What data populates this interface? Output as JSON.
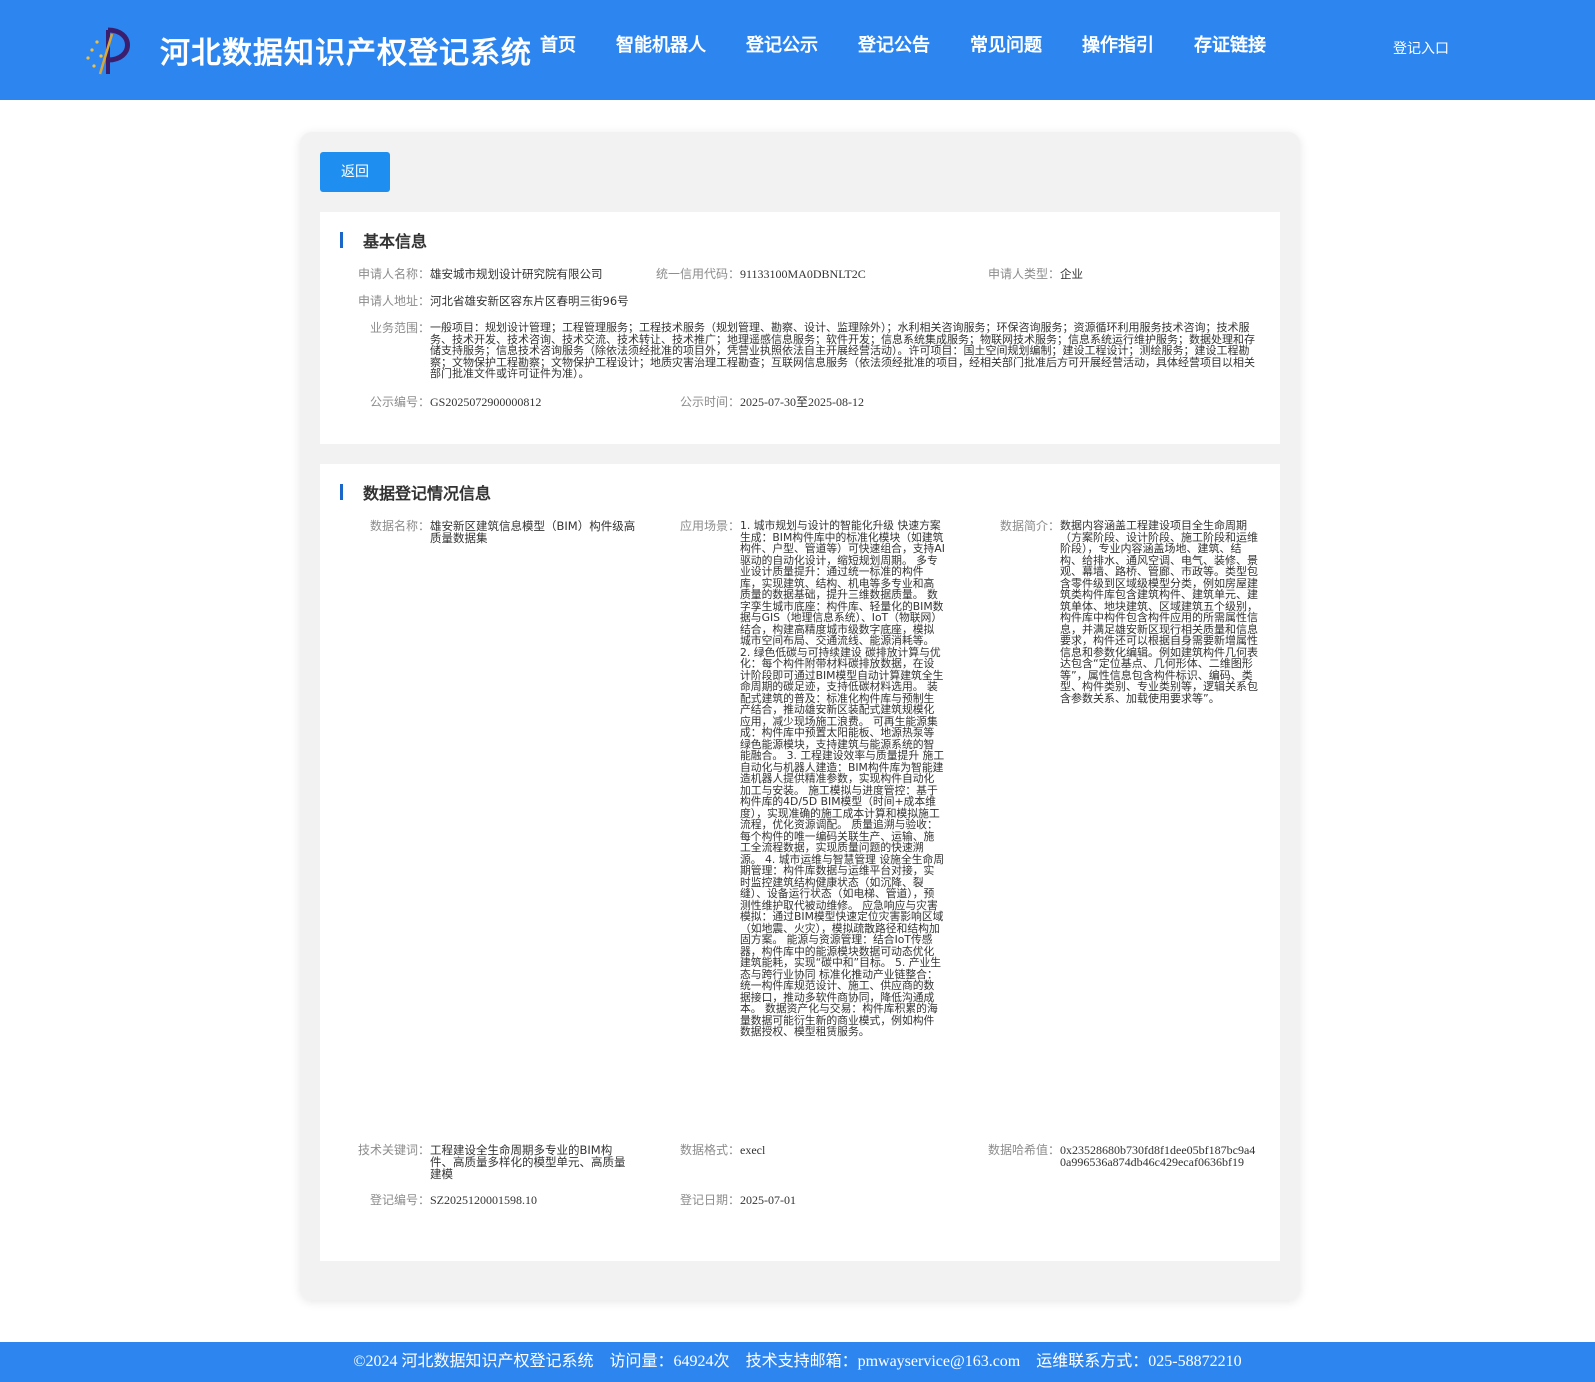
{
  "header": {
    "title": "河北数据知识产权登记系统",
    "nav": [
      "首页",
      "智能机器人",
      "登记公示",
      "登记公告",
      "常见问题",
      "操作指引",
      "存证链接"
    ],
    "login": "登记入口"
  },
  "back_label": "返回",
  "basic": {
    "title": "基本信息",
    "applicant_name_label": "申请人名称：",
    "applicant_name": "雄安城市规划设计研究院有限公司",
    "credit_code_label": "统一信用代码：",
    "credit_code": "91133100MA0DBNLT2C",
    "applicant_type_label": "申请人类型：",
    "applicant_type": "企业",
    "address_label": "申请人地址：",
    "address": "河北省雄安新区容东片区春明三街96号",
    "scope_label": "业务范围：",
    "scope": "一般项目：规划设计管理；工程管理服务；工程技术服务（规划管理、勘察、设计、监理除外）；水利相关咨询服务；环保咨询服务；资源循环利用服务技术咨询；技术服务、技术开发、技术咨询、技术交流、技术转让、技术推广；地理遥感信息服务；软件开发；信息系统集成服务；物联网技术服务；信息系统运行维护服务；数据处理和存储支持服务；信息技术咨询服务（除依法须经批准的项目外，凭营业执照依法自主开展经营活动）。许可项目：国土空间规划编制；建设工程设计；测绘服务；建设工程勘察；文物保护工程勘察；文物保护工程设计；地质灾害治理工程勘查；互联网信息服务（依法须经批准的项目，经相关部门批准后方可开展经营活动，具体经营项目以相关部门批准文件或许可证件为准）。",
    "notice_no_label": "公示编号：",
    "notice_no": "GS2025072900000812",
    "notice_time_label": "公示时间：",
    "notice_time": "2025-07-30至2025-08-12"
  },
  "data": {
    "title": "数据登记情况信息",
    "name_label": "数据名称：",
    "name": "雄安新区建筑信息模型（BIM）构件级高质量数据集",
    "scene_label": "应用场景：",
    "scene": "1. 城市规划与设计的智能化升级 快速方案生成：BIM构件库中的标准化模块（如建筑构件、户型、管道等）可快速组合，支持AI驱动的自动化设计，缩短规划周期。 多专业设计质量提升：通过统一标准的构件库，实现建筑、结构、机电等多专业和高质量的数据基础，提升三维数据质量。 数字孪生城市底座：构件库、轻量化的BIM数据与GIS（地理信息系统）、IoT（物联网）结合，构建高精度城市级数字底座，模拟城市空间布局、交通流线、能源消耗等。 2. 绿色低碳与可持续建设 碳排放计算与优化：每个构件附带材料碳排放数据，在设计阶段即可通过BIM模型自动计算建筑全生命周期的碳足迹，支持低碳材料选用。 装配式建筑的普及：标准化构件库与预制生产结合，推动雄安新区装配式建筑规模化应用，减少现场施工浪费。 可再生能源集成：构件库中预置太阳能板、地源热泵等绿色能源模块，支持建筑与能源系统的智能融合。 3. 工程建设效率与质量提升 施工自动化与机器人建造：BIM构件库为智能建造机器人提供精准参数，实现构件自动化加工与安装。 施工模拟与进度管控：基于构件库的4D/5D BIM模型（时间+成本维度），实现准确的施工成本计算和模拟施工流程，优化资源调配。 质量追溯与验收：每个构件的唯一编码关联生产、运输、施工全流程数据，实现质量问题的快速溯源。 4. 城市运维与智慧管理 设施全生命周期管理：构件库数据与运维平台对接，实时监控建筑结构健康状态（如沉降、裂缝）、设备运行状态（如电梯、管道），预测性维护取代被动维修。 应急响应与灾害模拟：通过BIM模型快速定位灾害影响区域（如地震、火灾），模拟疏散路径和结构加固方案。 能源与资源管理：结合IoT传感器，构件库中的能源模块数据可动态优化建筑能耗，实现“碳中和”目标。 5. 产业生态与跨行业协同 标准化推动产业链整合：统一构件库规范设计、施工、供应商的数据接口，推动多软件商协同，降低沟通成本。 数据资产化与交易：构件库积累的海量数据可能衍生新的商业模式，例如构件数据授权、模型租赁服务。",
    "intro_label": "数据简介：",
    "intro": "数据内容涵盖工程建设项目全生命周期（方案阶段、设计阶段、施工阶段和运维阶段），专业内容涵盖场地、建筑、结构、给排水、通风空调、电气、装修、景观、幕墙、路桥、管廊、市政等。类型包含零件级到区域级模型分类，例如房屋建筑类构件库包含建筑构件、建筑单元、建筑单体、地块建筑、区域建筑五个级别，构件库中构件包含构件应用的所需属性信息，并满足雄安新区现行相关质量和信息要求，构件还可以根据自身需要新增属性信息和参数化编辑。例如建筑构件几何表达包含“定位基点、几何形体、二维图形等”，属性信息包含构件标识、编码、类型、构件类别、专业类别等，逻辑关系包含参数关系、加载使用要求等”。",
    "keywords_label": "技术关键词：",
    "keywords": "工程建设全生命周期多专业的BIM构件、高质量多样化的模型单元、高质量建模",
    "format_label": "数据格式：",
    "format": "execl",
    "hash_label": "数据哈希值：",
    "hash": "0x23528680b730fd8f1dee05bf187bc9a40a996536a874db46c429ecaf0636bf19",
    "reg_no_label": "登记编号：",
    "reg_no": "SZ2025120001598.10",
    "reg_date_label": "登记日期：",
    "reg_date": "2025-07-01"
  },
  "footer": {
    "copyright": "©2024 河北数据知识产权登记系统",
    "visits": "访问量：64924次",
    "email": "技术支持邮箱：pmwayservice@163.com",
    "contact": "运维联系方式：025-58872210"
  }
}
